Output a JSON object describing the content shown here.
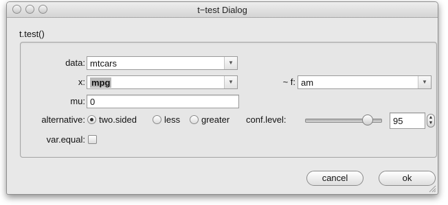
{
  "window": {
    "title": "t−test Dialog"
  },
  "group": {
    "title": "t.test()"
  },
  "fields": {
    "data": {
      "label": "data:",
      "value": "mtcars"
    },
    "x": {
      "label": "x:",
      "value": "mpg"
    },
    "f": {
      "label": "~ f:",
      "value": "am"
    },
    "mu": {
      "label": "mu:",
      "value": "0"
    },
    "alternative": {
      "label": "alternative:",
      "options": [
        "two.sided",
        "less",
        "greater"
      ],
      "selected": "two.sided"
    },
    "conf_level": {
      "label": "conf.level:",
      "value": "95",
      "slider_fraction": 0.83
    },
    "var_equal": {
      "label": "var.equal:",
      "checked": false
    }
  },
  "buttons": {
    "cancel": "cancel",
    "ok": "ok"
  },
  "icons": {
    "dropdown": "chevron-down-icon",
    "spinner": "up-down-arrows-icon",
    "resize": "resize-grip-icon"
  }
}
